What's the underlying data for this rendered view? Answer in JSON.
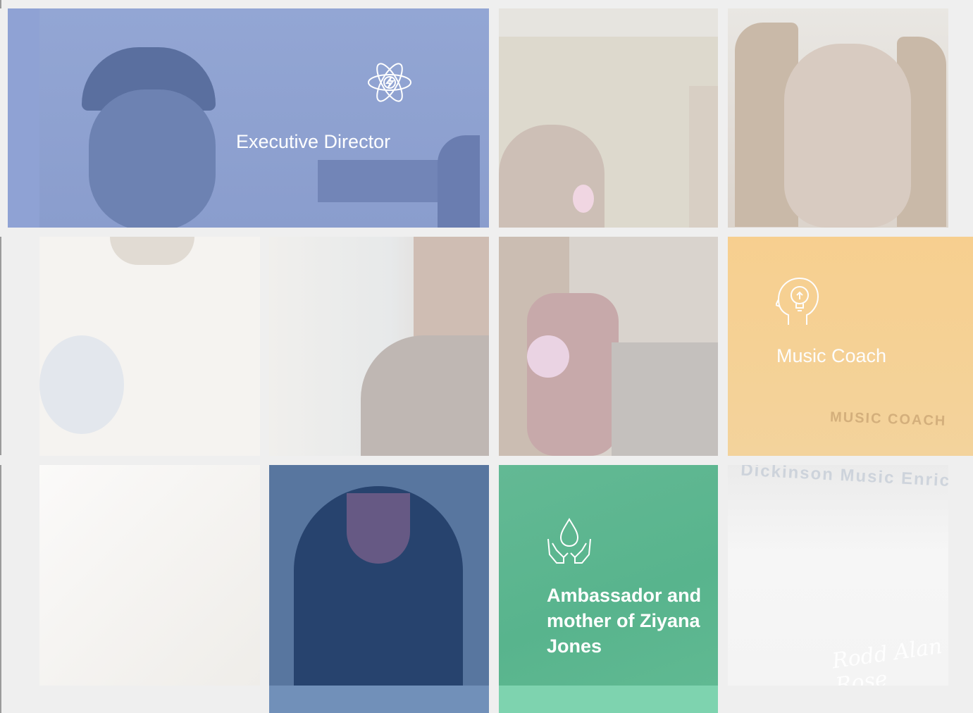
{
  "cards": {
    "executive": {
      "title": "Executive Director",
      "icon": "atom-lightning-icon",
      "color": "#8fa2d4"
    },
    "music": {
      "title": "Music Coach",
      "icon": "head-lightbulb-icon",
      "color": "#f6cb85"
    },
    "ambassador": {
      "title": "Ambassador and mother of Ziyana Jones",
      "icon": "hands-water-drop-icon",
      "color": "#5bb791"
    }
  },
  "photo_text": {
    "shirt_music": "MUSIC COACH",
    "shirt_center": "Dickinson Music Enrichment Center",
    "signature": "Rodd Alan Rose"
  },
  "colors": {
    "page_bg": "#efefef",
    "blue_overlay": "#8fa2d4",
    "orange_overlay": "#f6cb85",
    "green_overlay": "#5bb791",
    "navy": "#4a6e9c"
  }
}
